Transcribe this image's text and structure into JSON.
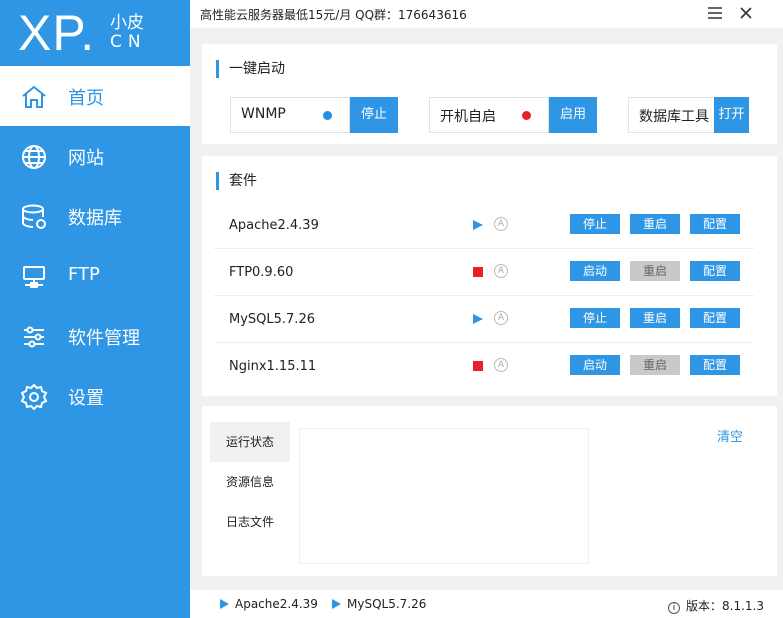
{
  "app": {
    "logo_main": "XP.",
    "logo_cn": "小皮",
    "logo_suffix": "CN"
  },
  "header": {
    "ad_text": "高性能云服务器最低15元/月  QQ群：176643616"
  },
  "sidebar": {
    "items": [
      {
        "label": "首页",
        "icon": "home-icon"
      },
      {
        "label": "网站",
        "icon": "globe-icon"
      },
      {
        "label": "数据库",
        "icon": "database-icon"
      },
      {
        "label": "FTP",
        "icon": "ftp-icon"
      },
      {
        "label": "软件管理",
        "icon": "sliders-icon"
      },
      {
        "label": "设置",
        "icon": "gear-icon"
      }
    ]
  },
  "quick_start": {
    "title": "一键启动",
    "items": [
      {
        "label": "WNMP",
        "status_color": "#1e90e8",
        "button": "停止"
      },
      {
        "label": "开机自启",
        "status_color": "#e8202a",
        "button": "启用"
      },
      {
        "label": "数据库工具",
        "button": "打开"
      }
    ]
  },
  "suite": {
    "title": "套件",
    "rows": [
      {
        "name": "Apache2.4.39",
        "state": "running",
        "auto": "A",
        "b1": "停止",
        "b2": "重启",
        "b3": "配置",
        "b2_disabled": false
      },
      {
        "name": "FTP0.9.60",
        "state": "stopped",
        "auto": "A",
        "b1": "启动",
        "b2": "重启",
        "b3": "配置",
        "b2_disabled": true
      },
      {
        "name": "MySQL5.7.26",
        "state": "running",
        "auto": "A",
        "b1": "停止",
        "b2": "重启",
        "b3": "配置",
        "b2_disabled": false
      },
      {
        "name": "Nginx1.15.11",
        "state": "stopped",
        "auto": "A",
        "b1": "启动",
        "b2": "重启",
        "b3": "配置",
        "b2_disabled": true
      }
    ]
  },
  "log_panel": {
    "tabs": [
      "运行状态",
      "资源信息",
      "日志文件"
    ],
    "clear": "清空"
  },
  "statusbar": {
    "items": [
      "Apache2.4.39",
      "MySQL5.7.26"
    ],
    "version": "版本：8.1.1.3"
  },
  "colors": {
    "accent": "#2e96e4",
    "running": "#2e96e4",
    "stopped": "#e8202a"
  }
}
